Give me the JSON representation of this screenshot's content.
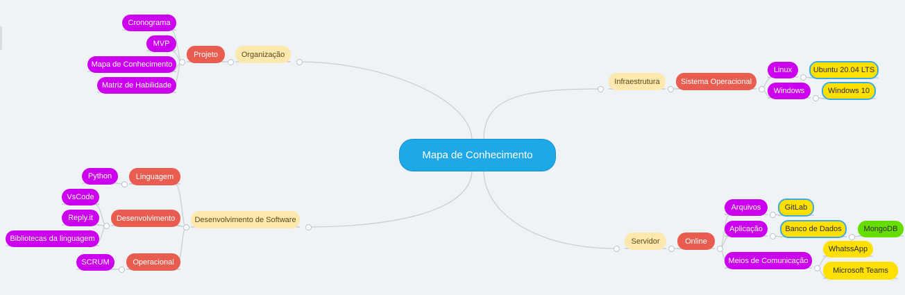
{
  "mindmap": {
    "root": "Mapa de Conhecimento",
    "branches": [
      {
        "key": "org",
        "label": "Organização",
        "children": [
          {
            "key": "projeto",
            "label": "Projeto",
            "children": [
              {
                "key": "crono",
                "label": "Cronograma"
              },
              {
                "key": "mvp",
                "label": "MVP"
              },
              {
                "key": "mapa",
                "label": "Mapa de Conhecimento"
              },
              {
                "key": "matriz",
                "label": "Matriz de Habilidade"
              }
            ]
          }
        ]
      },
      {
        "key": "dev",
        "label": "Desenvolvimento de Software",
        "children": [
          {
            "key": "ling",
            "label": "Linguagem",
            "children": [
              {
                "key": "python",
                "label": "Python"
              }
            ]
          },
          {
            "key": "desenv",
            "label": "Desenvolvimento",
            "children": [
              {
                "key": "vscode",
                "label": "VsCode"
              },
              {
                "key": "replit",
                "label": "Reply.it"
              },
              {
                "key": "biblio",
                "label": "Bibliotecas da linguagem"
              }
            ]
          },
          {
            "key": "oper",
            "label": "Operacional",
            "children": [
              {
                "key": "scrum",
                "label": "SCRUM"
              }
            ]
          }
        ]
      },
      {
        "key": "infra",
        "label": "Infraestrutura",
        "children": [
          {
            "key": "so",
            "label": "Sistema Operacional",
            "children": [
              {
                "key": "linux",
                "label": "Linux",
                "children": [
                  {
                    "key": "ubuntu",
                    "label": "Ubuntu 20.04 LTS"
                  }
                ]
              },
              {
                "key": "windows",
                "label": "Windows",
                "children": [
                  {
                    "key": "win10",
                    "label": "Windows 10"
                  }
                ]
              }
            ]
          }
        ]
      },
      {
        "key": "serv",
        "label": "Servidor",
        "children": [
          {
            "key": "online",
            "label": "Online",
            "children": [
              {
                "key": "arquivos",
                "label": "Arquivos",
                "children": [
                  {
                    "key": "gitlab",
                    "label": "GitLab"
                  }
                ]
              },
              {
                "key": "aplic",
                "label": "Aplicação",
                "children": [
                  {
                    "key": "bd",
                    "label": "Banco de Dados",
                    "children": [
                      {
                        "key": "mongo",
                        "label": "MongoDB"
                      }
                    ]
                  }
                ]
              },
              {
                "key": "meios",
                "label": "Meios de Comunicação",
                "children": [
                  {
                    "key": "whats",
                    "label": "WhatssApp"
                  },
                  {
                    "key": "teams",
                    "label": "Microsoft Teams"
                  }
                ]
              }
            ]
          }
        ]
      }
    ]
  },
  "colors": {
    "root": "#1ea8e8",
    "level1": "#fde8ae",
    "level2": "#e85d4f",
    "level3": "#cc00ee",
    "leaf_yellow": "#ffe000",
    "leaf_green": "#66dd00",
    "connector": "#c5ccd3"
  }
}
